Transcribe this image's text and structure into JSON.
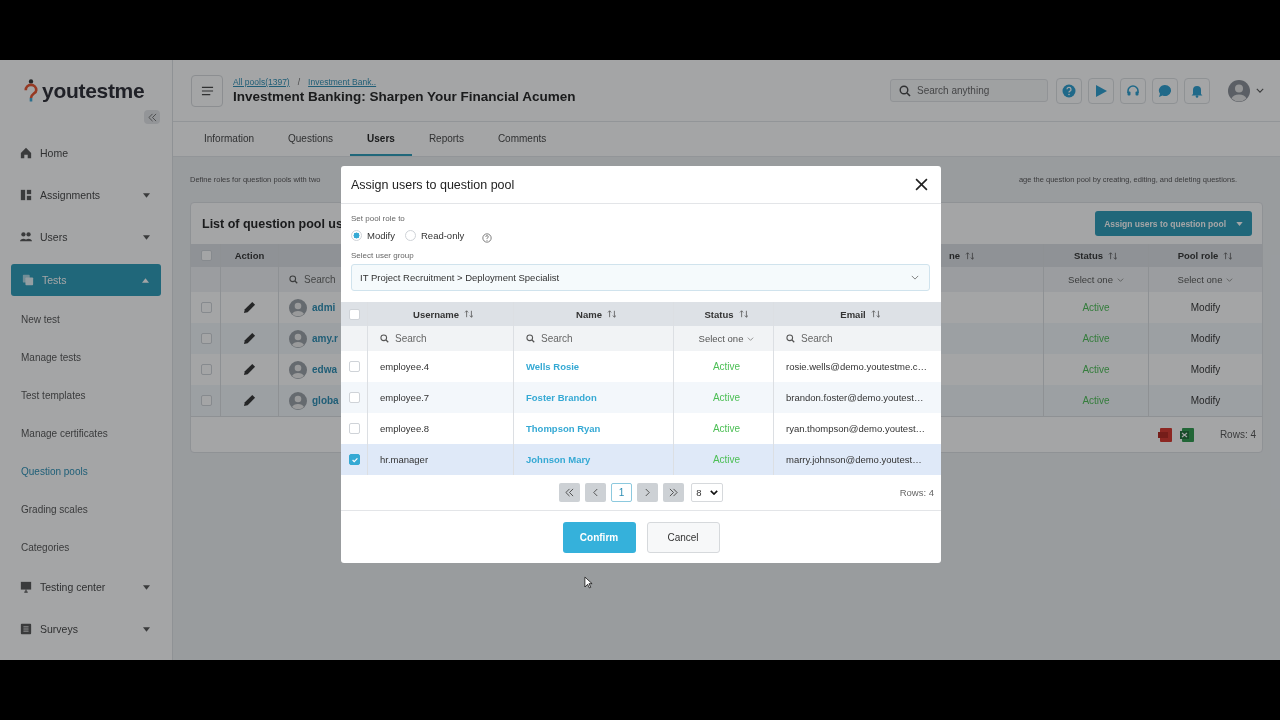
{
  "sidebar": {
    "logo": "youtestme",
    "items": [
      {
        "label": "Home",
        "kind": "link",
        "selected": false
      },
      {
        "label": "Assignments",
        "kind": "group",
        "selected": false,
        "expanded": false
      },
      {
        "label": "Users",
        "kind": "group",
        "selected": false,
        "expanded": false
      },
      {
        "label": "Tests",
        "kind": "group",
        "selected": true,
        "expanded": true,
        "children": [
          {
            "label": "New test",
            "selected": false
          },
          {
            "label": "Manage tests",
            "selected": false
          },
          {
            "label": "Test templates",
            "selected": false
          },
          {
            "label": "Manage certificates",
            "selected": false
          },
          {
            "label": "Question pools",
            "selected": true
          },
          {
            "label": "Grading scales",
            "selected": false
          },
          {
            "label": "Categories",
            "selected": false
          }
        ]
      },
      {
        "label": "Testing center",
        "kind": "group",
        "selected": false,
        "expanded": false
      },
      {
        "label": "Surveys",
        "kind": "group",
        "selected": false,
        "expanded": false
      }
    ]
  },
  "header": {
    "breadcrumbs": [
      "All pools(1397)",
      "Investment Bank.."
    ],
    "breadcrumb_separator": "/",
    "title": "Investment Banking: Sharpen Your Financial Acumen",
    "search": {
      "placeholder": "Search anything"
    }
  },
  "tabs": [
    {
      "label": "Information",
      "selected": false
    },
    {
      "label": "Questions",
      "selected": false
    },
    {
      "label": "Users",
      "selected": true
    },
    {
      "label": "Reports",
      "selected": false
    },
    {
      "label": "Comments",
      "selected": false
    }
  ],
  "description_parts": [
    "Define roles for question pools with two",
    "age the question pool by creating, editing, and deleting questions."
  ],
  "card": {
    "title": "List of question pool us",
    "assign_button": "Assign users to question pool",
    "all_checked": false,
    "columns": [
      "Action",
      "ne",
      "Status",
      "Pool role"
    ],
    "filters": {
      "user": {
        "placeholder": "Search"
      },
      "status": {
        "placeholder": "Select one"
      },
      "role": {
        "placeholder": "Select one"
      }
    },
    "rows": [
      {
        "username": "admi",
        "status": "Active",
        "role": "Modify",
        "checked": false
      },
      {
        "username": "amy.r",
        "status": "Active",
        "role": "Modify",
        "checked": false
      },
      {
        "username": "edwa",
        "status": "Active",
        "role": "Modify",
        "checked": false
      },
      {
        "username": "globa",
        "status": "Active",
        "role": "Modify",
        "checked": false
      }
    ],
    "rows_count": "Rows: 4"
  },
  "modal": {
    "title": "Assign users to question pool",
    "role_label": "Set pool role to",
    "roles": [
      {
        "label": "Modify",
        "selected": true
      },
      {
        "label": "Read-only",
        "selected": false
      }
    ],
    "group_label": "Select user group",
    "group_value": "IT Project Recruitment > Deployment Specialist",
    "table": {
      "all_checked": false,
      "columns": [
        "Username",
        "Name",
        "Status",
        "Email"
      ],
      "filters": {
        "username": {
          "placeholder": "Search"
        },
        "name": {
          "placeholder": "Search"
        },
        "status": {
          "placeholder": "Select one"
        },
        "email": {
          "placeholder": "Search"
        }
      },
      "rows": [
        {
          "username": "employee.4",
          "name": "Wells Rosie",
          "status": "Active",
          "email": "rosie.wells@demo.youtestme.c…",
          "checked": false
        },
        {
          "username": "employee.7",
          "name": "Foster Brandon",
          "status": "Active",
          "email": "brandon.foster@demo.youtest…",
          "checked": false
        },
        {
          "username": "employee.8",
          "name": "Thompson Ryan",
          "status": "Active",
          "email": "ryan.thompson@demo.youtest…",
          "checked": false
        },
        {
          "username": "hr.manager",
          "name": "Johnson Mary",
          "status": "Active",
          "email": "marry.johnson@demo.youtest…",
          "checked": true
        }
      ]
    },
    "pagination": {
      "pages": [
        {
          "label": "1",
          "selected": true
        }
      ],
      "page_size": "8",
      "rows_count": "Rows: 4"
    },
    "confirm": "Confirm",
    "cancel": "Cancel"
  }
}
